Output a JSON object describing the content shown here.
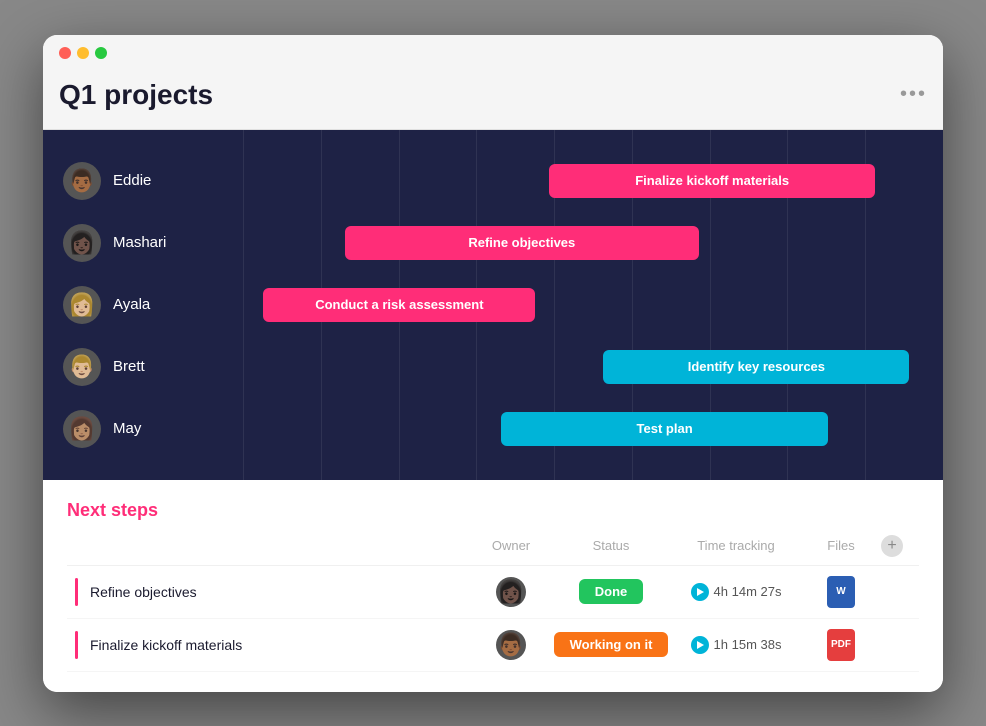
{
  "window": {
    "title": "Q1 projects",
    "more_label": "•••"
  },
  "gantt": {
    "rows": [
      {
        "person": "Eddie",
        "face_class": "face-eddie",
        "bar": {
          "label": "Finalize kickoff materials",
          "color": "bar-pink",
          "left": "45%",
          "width": "48%"
        }
      },
      {
        "person": "Mashari",
        "face_class": "face-mashari",
        "bar": {
          "label": "Refine objectives",
          "color": "bar-pink",
          "left": "15%",
          "width": "52%"
        }
      },
      {
        "person": "Ayala",
        "face_class": "face-ayala",
        "bar": {
          "label": "Conduct a risk assessment",
          "color": "bar-pink",
          "left": "3%",
          "width": "40%"
        }
      },
      {
        "person": "Brett",
        "face_class": "face-brett",
        "bar": {
          "label": "Identify key resources",
          "color": "bar-cyan",
          "left": "53%",
          "width": "45%"
        }
      },
      {
        "person": "May",
        "face_class": "face-may",
        "bar": {
          "label": "Test plan",
          "color": "bar-cyan",
          "left": "38%",
          "width": "48%"
        }
      }
    ]
  },
  "next_steps": {
    "title": "Next steps",
    "columns": {
      "owner": "Owner",
      "status": "Status",
      "time_tracking": "Time tracking",
      "files": "Files"
    },
    "rows": [
      {
        "task": "Refine objectives",
        "owner_face": "face-mashari",
        "status_label": "Done",
        "status_class": "status-done",
        "time": "4h 14m 27s",
        "file_type": "word",
        "file_label": "W"
      },
      {
        "task": "Finalize kickoff materials",
        "owner_face": "face-eddie",
        "status_label": "Working on it",
        "status_class": "status-working",
        "time": "1h 15m 38s",
        "file_type": "pdf",
        "file_label": "PDF"
      }
    ],
    "add_label": "+"
  }
}
